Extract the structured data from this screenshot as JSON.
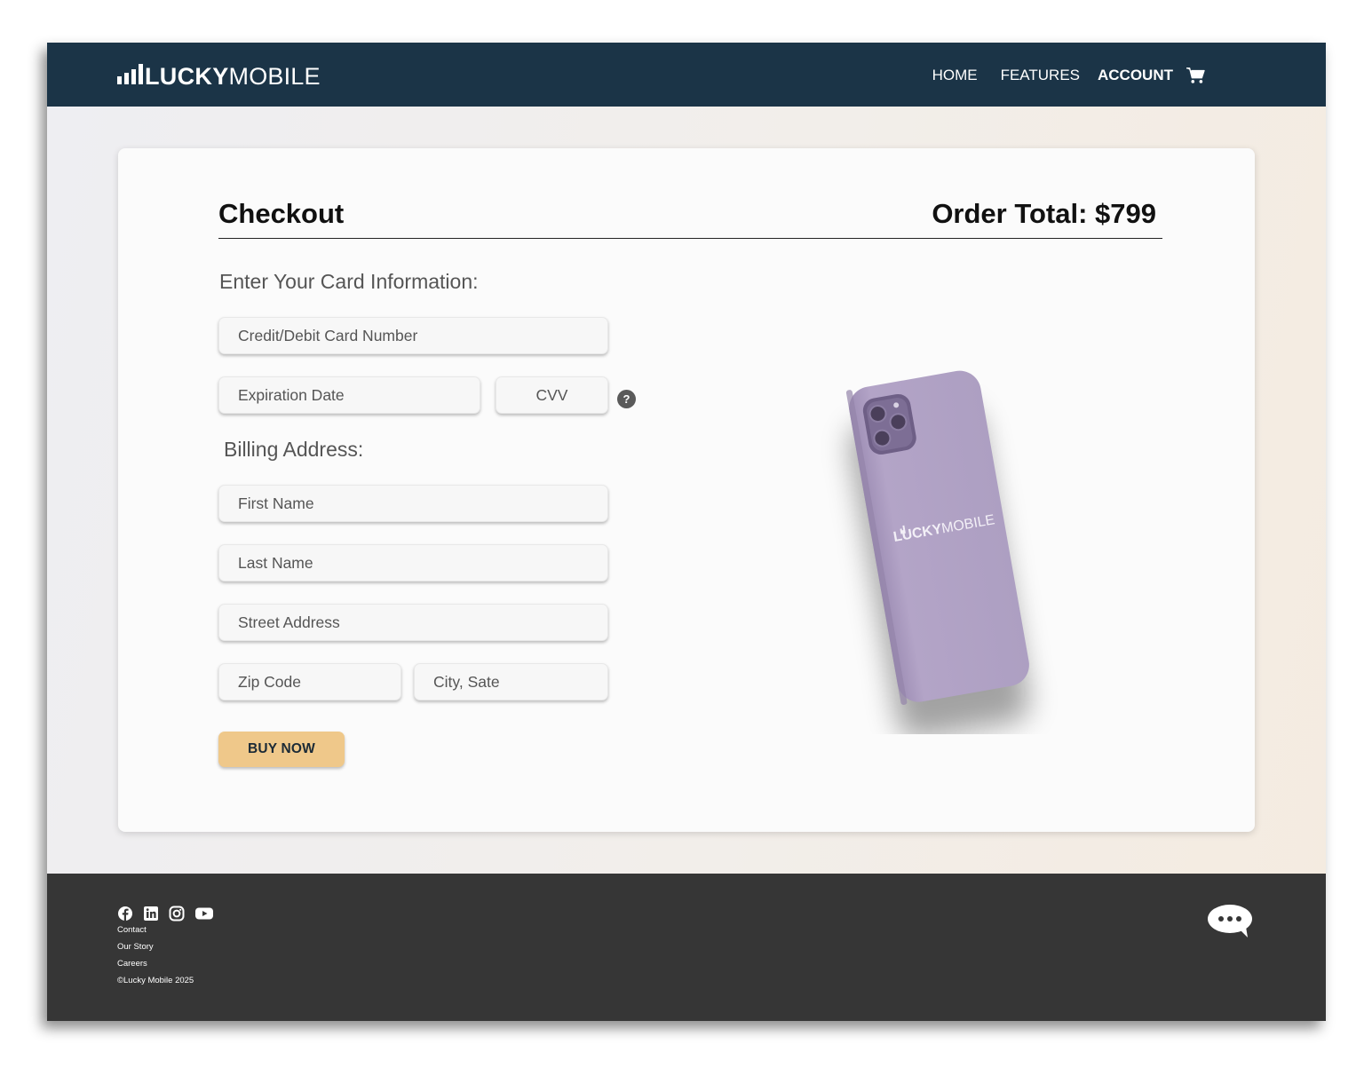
{
  "brand": {
    "lucky": "LUCKY",
    "mobile": "MOBILE"
  },
  "nav": {
    "items": [
      "HOME",
      "FEATURES",
      "ACCOUNT"
    ],
    "active": "ACCOUNT",
    "cart_icon": "cart-icon"
  },
  "checkout": {
    "title": "Checkout",
    "order_total": "Order Total: $799",
    "card_section": "Enter Your Card Information:",
    "card_number_placeholder": "Credit/Debit Card Number",
    "expiration_placeholder": "Expiration Date",
    "cvv_placeholder": "CVV",
    "help_symbol": "?",
    "billing_section": "Billing Address:",
    "first_name_placeholder": "First Name",
    "last_name_placeholder": "Last Name",
    "street_placeholder": "Street Address",
    "zip_placeholder": "Zip Code",
    "city_placeholder": "City, Sate",
    "buy_label": "BUY NOW"
  },
  "product_image": {
    "logo_lucky": "LUCKY",
    "logo_mobile": "MOBILE",
    "case_color": "#b1a2c6"
  },
  "footer": {
    "social_icons": [
      "facebook-icon",
      "linkedin-icon",
      "instagram-icon",
      "youtube-icon"
    ],
    "links": [
      "Contact",
      "Our Story",
      "Careers"
    ],
    "copyright": "©Lucky Mobile 2025",
    "chat_icon": "chat-bubble-icon"
  },
  "colors": {
    "nav_bg": "#1b3447",
    "footer_bg": "#363636",
    "button_bg": "#efc88a"
  }
}
